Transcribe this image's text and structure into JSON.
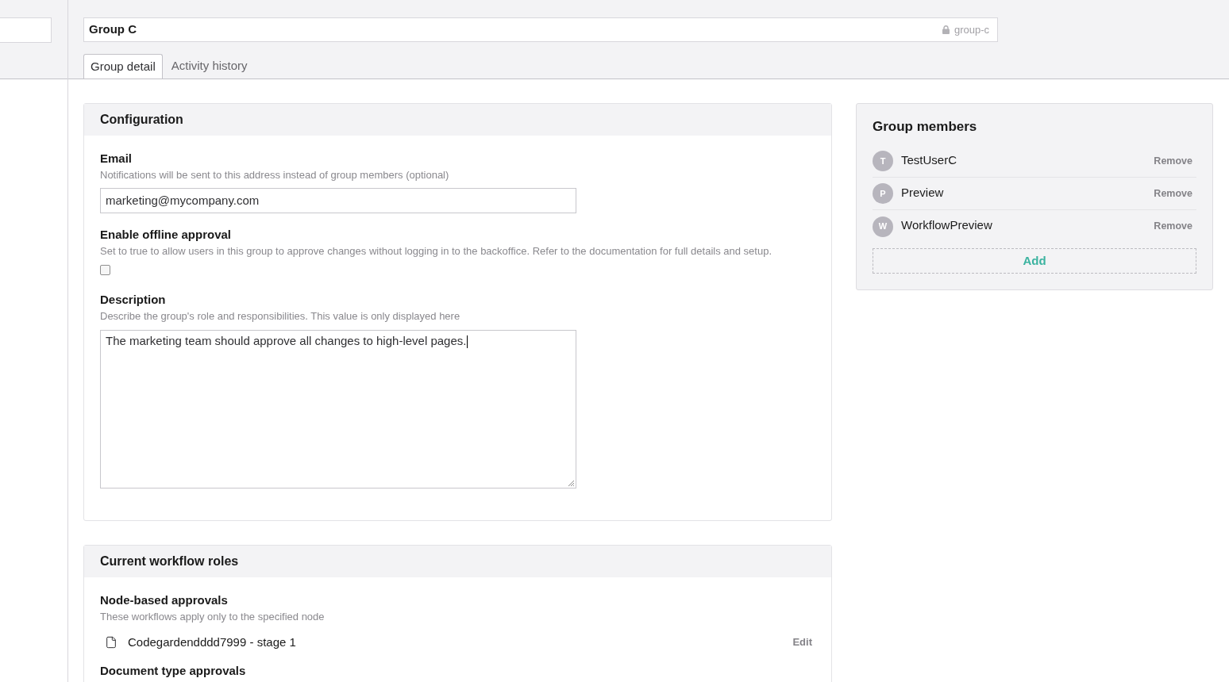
{
  "header": {
    "name_field": {
      "value": "Group C",
      "alias": "group-c"
    },
    "tabs": [
      {
        "label": "Group detail",
        "selected": true
      },
      {
        "label": "Activity history",
        "selected": false
      }
    ]
  },
  "configuration": {
    "title": "Configuration",
    "fields": [
      {
        "kind": "text",
        "label": "Email",
        "description": "Notifications will be sent to this address instead of group members (optional)",
        "value": "marketing@mycompany.com"
      },
      {
        "kind": "checkbox",
        "label": "Enable offline approval",
        "description": "Set to true to allow users in this group to approve changes without logging in to the backoffice. Refer to the documentation for full details and setup.",
        "checked": false
      },
      {
        "kind": "textarea",
        "label": "Description",
        "description": "Describe the group's role and responsibilities. This value is only displayed here",
        "value": "The marketing team should approve all changes to high-level pages.",
        "focused": true
      }
    ]
  },
  "workflow_roles": {
    "title": "Current workflow roles",
    "sections": [
      {
        "title": "Node-based approvals",
        "description": "These workflows apply only to the specified node",
        "items": [
          {
            "label": "Codegardendddd7999 - stage 1",
            "action": "Edit"
          }
        ]
      },
      {
        "title": "Document type approvals"
      }
    ]
  },
  "members": {
    "title": "Group members",
    "items": [
      {
        "initial": "T",
        "name": "TestUserC",
        "action": "Remove"
      },
      {
        "initial": "P",
        "name": "Preview",
        "action": "Remove"
      },
      {
        "initial": "W",
        "name": "WorkflowPreview",
        "action": "Remove"
      }
    ],
    "add_label": "Add"
  }
}
